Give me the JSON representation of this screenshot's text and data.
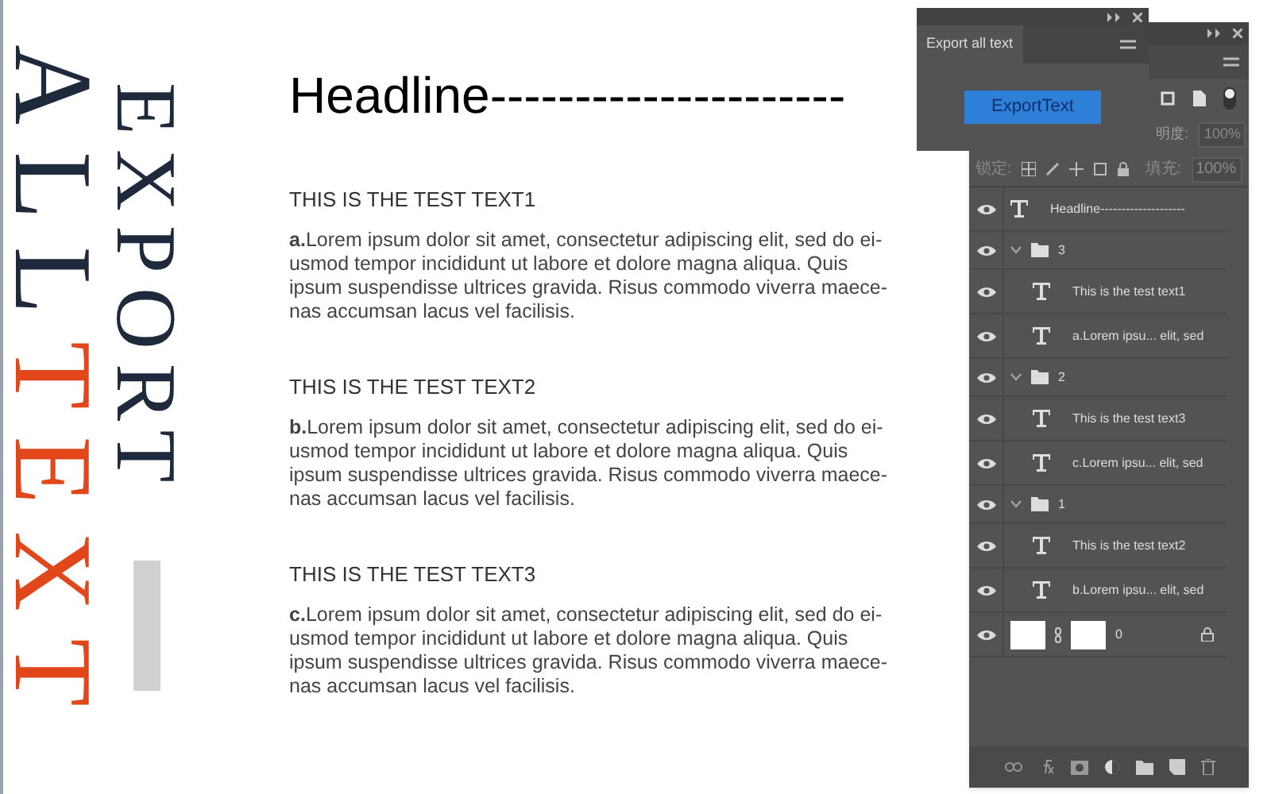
{
  "poster": {
    "word_1": "EXPORT",
    "word_2": "ALL",
    "word_3": "TEXT"
  },
  "document": {
    "headline": "Headline---------------------",
    "sections": [
      {
        "heading": "THIS IS THE TEST TEXT1",
        "body": "**a.**Lorem ipsum dolor sit amet, consectetur adipiscing elit, sed do ei-usmod tempor incididunt ut labore et dolore magna aliqua. Quis ipsum suspendisse ultrices gravida. Risus commodo viverra maece-nas accumsan lacus vel facilisis."
      },
      {
        "heading": "THIS IS THE TEST TEXT2",
        "body": "**b.**Lorem ipsum dolor sit amet, consectetur adipiscing elit, sed do ei-usmod tempor incididunt ut labore et dolore magna aliqua. Quis ipsum suspendisse ultrices gravida. Risus commodo viverra maece-nas accumsan lacus vel facilisis."
      },
      {
        "heading": "THIS IS THE TEST TEXT3",
        "body": "**c.**Lorem ipsum dolor sit amet, consectetur adipiscing elit, sed do ei-usmod tempor incididunt ut labore et dolore magna aliqua. Quis ipsum suspendisse ultrices gravida. Risus commodo viverra maece-nas accumsan lacus vel facilisis."
      }
    ]
  },
  "export_panel": {
    "tab": "Export all text",
    "button": "ExportText"
  },
  "layers_panel": {
    "opacity_label": "明度:",
    "opacity": "100%",
    "lock_label": "锁定:",
    "fill_label": "填充:",
    "fill": "100%",
    "layers": [
      {
        "kind": "text",
        "name": "Headline--------------------",
        "visible": true
      },
      {
        "kind": "group",
        "name": "3",
        "visible": true,
        "expanded": true,
        "children": [
          {
            "kind": "text",
            "name": "This is the test text1",
            "visible": true
          },
          {
            "kind": "text",
            "name": "a.Lorem ipsu... elit, sed",
            "visible": true
          }
        ]
      },
      {
        "kind": "group",
        "name": "2",
        "visible": true,
        "expanded": true,
        "children": [
          {
            "kind": "text",
            "name": "This is the test text3",
            "visible": true
          },
          {
            "kind": "text",
            "name": "c.Lorem ipsu... elit, sed",
            "visible": true
          }
        ]
      },
      {
        "kind": "group",
        "name": "1",
        "visible": true,
        "expanded": true,
        "children": [
          {
            "kind": "text",
            "name": "This is the test text2",
            "visible": true
          },
          {
            "kind": "text",
            "name": "b.Lorem ipsu... elit, sed",
            "visible": true
          }
        ]
      },
      {
        "kind": "image",
        "name": "0",
        "visible": true,
        "locked": true
      }
    ]
  }
}
